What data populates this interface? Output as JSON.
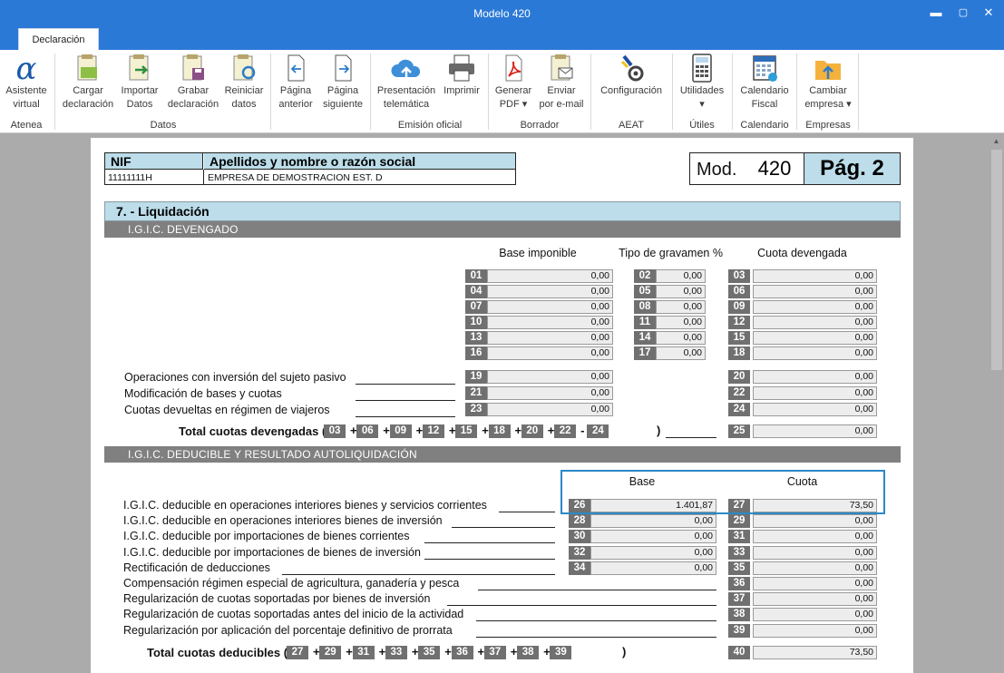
{
  "window": {
    "title": "Modelo 420"
  },
  "tabs": [
    {
      "label": "Declaración"
    }
  ],
  "ribbon": {
    "buttons": {
      "asistente": "Asistente\nvirtual",
      "cargar": "Cargar\ndeclaración",
      "importar": "Importar\nDatos",
      "grabar": "Grabar\ndeclaración",
      "reiniciar": "Reiniciar\ndatos",
      "anterior": "Página\nanterior",
      "siguiente": "Página\nsiguiente",
      "presentacion": "Presentación\ntelemática",
      "imprimir": "Imprimir",
      "generar": "Generar\nPDF ▾",
      "enviar": "Enviar\npor e-mail",
      "configuracion": "Configuración",
      "utilidades": "Utilidades\n▾",
      "calendario": "Calendario\nFiscal",
      "cambiar": "Cambiar\nempresa ▾"
    },
    "groups": {
      "atenea": "Atenea",
      "datos": "Datos",
      "emision": "Emisión oficial",
      "borrador": "Borrador",
      "aeat": "AEAT",
      "utiles": "Útiles",
      "calendario": "Calendario",
      "empresas": "Empresas"
    }
  },
  "header": {
    "nif_label": "NIF",
    "nif_value": "11111111H",
    "name_label": "Apellidos y nombre o razón social",
    "name_value": "EMPRESA DE DEMOSTRACION EST. D",
    "mod_label": "Mod.",
    "mod_value": "420",
    "page_label": "Pág. 2"
  },
  "section7": {
    "title": "7. - Liquidación",
    "devengado_title": "I.G.I.C. DEVENGADO",
    "col_base": "Base imponible",
    "col_tipo": "Tipo de gravamen %",
    "col_cuota": "Cuota devengada",
    "rows": [
      {
        "b": "01",
        "bv": "0,00",
        "t": "02",
        "tv": "0,00",
        "c": "03",
        "cv": "0,00"
      },
      {
        "b": "04",
        "bv": "0,00",
        "t": "05",
        "tv": "0,00",
        "c": "06",
        "cv": "0,00"
      },
      {
        "b": "07",
        "bv": "0,00",
        "t": "08",
        "tv": "0,00",
        "c": "09",
        "cv": "0,00"
      },
      {
        "b": "10",
        "bv": "0,00",
        "t": "11",
        "tv": "0,00",
        "c": "12",
        "cv": "0,00"
      },
      {
        "b": "13",
        "bv": "0,00",
        "t": "14",
        "tv": "0,00",
        "c": "15",
        "cv": "0,00"
      },
      {
        "b": "16",
        "bv": "0,00",
        "t": "17",
        "tv": "0,00",
        "c": "18",
        "cv": "0,00"
      }
    ],
    "extra": [
      {
        "label": "Operaciones con inversión del sujeto pasivo",
        "b": "19",
        "bv": "0,00",
        "c": "20",
        "cv": "0,00"
      },
      {
        "label": "Modificación de bases y cuotas",
        "b": "21",
        "bv": "0,00",
        "c": "22",
        "cv": "0,00"
      },
      {
        "label": "Cuotas devueltas en régimen de viajeros",
        "b": "23",
        "bv": "0,00",
        "c": "24",
        "cv": "0,00"
      }
    ],
    "total_dev_label": "Total cuotas devengadas (",
    "total_dev_boxes": [
      "03",
      "06",
      "09",
      "12",
      "15",
      "18",
      "20",
      "22",
      "24"
    ],
    "total_dev_ops": [
      "+",
      "+",
      "+",
      "+",
      "+",
      "+",
      "+",
      "-"
    ],
    "total_dev_close": ")",
    "total_dev_num": "25",
    "total_dev_value": "0,00",
    "deducible_title": "I.G.I.C. DEDUCIBLE Y RESULTADO AUTOLIQUIDACIÓN",
    "col_base2": "Base",
    "col_cuota2": "Cuota",
    "ded_rows": [
      {
        "label": "I.G.I.C. deducible en operaciones interiores bienes y servicios corrientes",
        "b": "26",
        "bv": "1.401,87",
        "c": "27",
        "cv": "73,50"
      },
      {
        "label": "I.G.I.C. deducible en operaciones interiores bienes de inversión",
        "b": "28",
        "bv": "0,00",
        "c": "29",
        "cv": "0,00"
      },
      {
        "label": "I.G.I.C. deducible por importaciones de bienes corrientes",
        "b": "30",
        "bv": "0,00",
        "c": "31",
        "cv": "0,00"
      },
      {
        "label": "I.G.I.C. deducible por importaciones de bienes de inversión",
        "b": "32",
        "bv": "0,00",
        "c": "33",
        "cv": "0,00"
      },
      {
        "label": "Rectificación de deducciones",
        "b": "34",
        "bv": "0,00",
        "c": "35",
        "cv": "0,00"
      }
    ],
    "ded_rows2": [
      {
        "label": "Compensación régimen especial de agricultura, ganadería y pesca",
        "c": "36",
        "cv": "0,00"
      },
      {
        "label": "Regularización de cuotas soportadas por bienes de inversión",
        "c": "37",
        "cv": "0,00"
      },
      {
        "label": "Regularización de cuotas soportadas antes del inicio de la actividad",
        "c": "38",
        "cv": "0,00"
      },
      {
        "label": "Regularización por aplicación del porcentaje definitivo de prorrata",
        "c": "39",
        "cv": "0,00"
      }
    ],
    "total_ded_label": "Total cuotas deducibles (",
    "total_ded_boxes": [
      "27",
      "29",
      "31",
      "33",
      "35",
      "36",
      "37",
      "38",
      "39"
    ],
    "total_ded_ops": [
      "+",
      "+",
      "+",
      "+",
      "+",
      "+",
      "+",
      "+"
    ],
    "total_ded_close": ")",
    "total_ded_num": "40",
    "total_ded_value": "73,50"
  },
  "colors": {
    "titlebar": "#2b79d7",
    "section_header": "#808080",
    "title_band": "#bcdde9",
    "focus": "#2b88c8"
  }
}
